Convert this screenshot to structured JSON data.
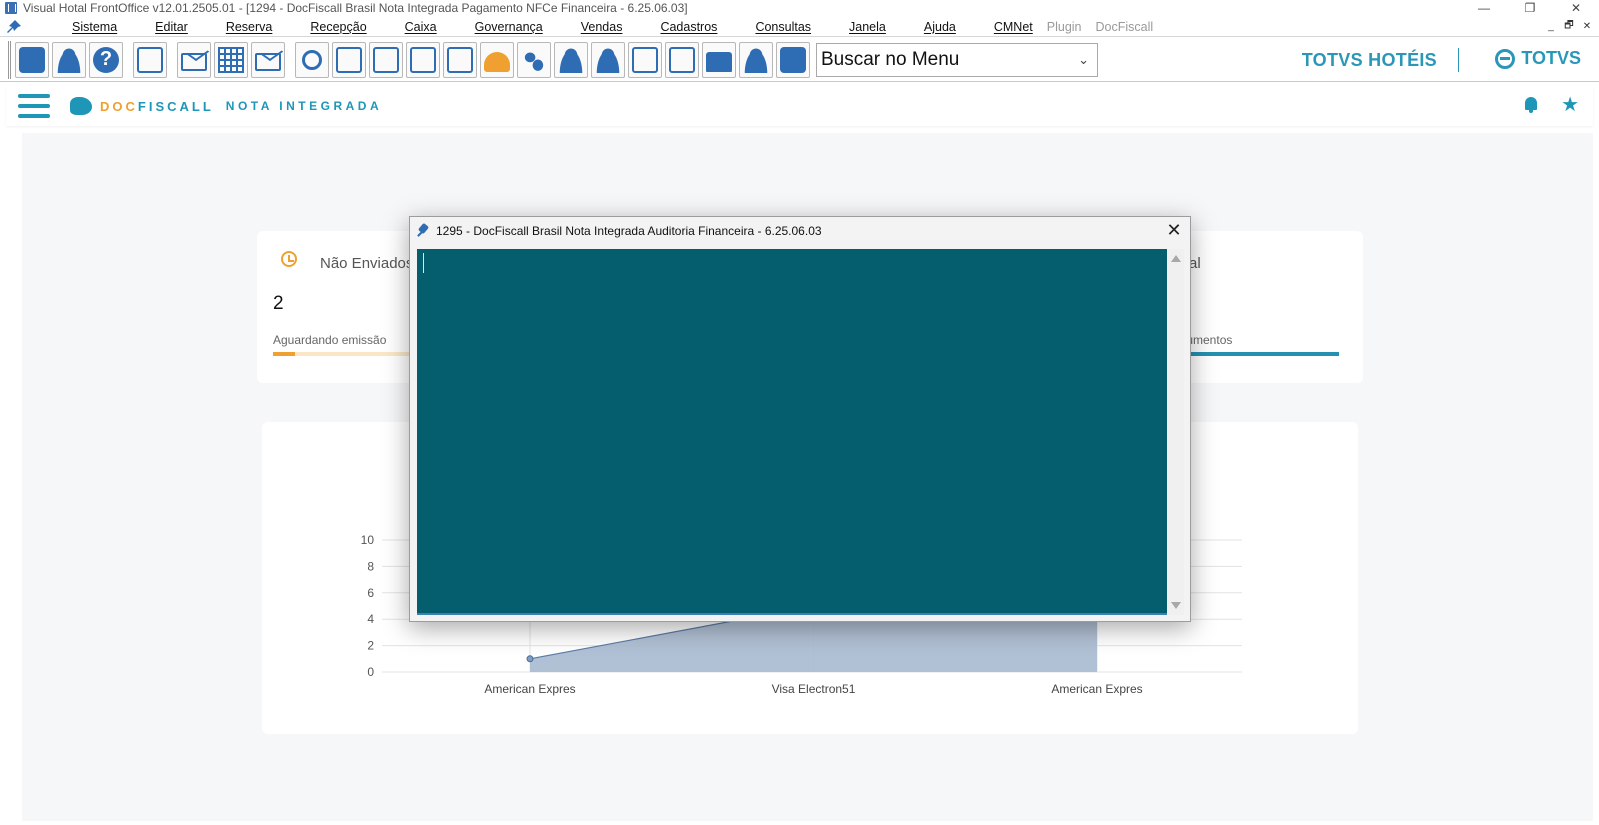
{
  "window": {
    "title": "Visual Hotal FrontOffice v12.01.2505.01 - [1294 - DocFiscall Brasil Nota Integrada Pagamento NFCe Financeira - 6.25.06.03]",
    "controls": {
      "minimize": "—",
      "maximize": "❐",
      "close": "✕"
    }
  },
  "menu": {
    "items": [
      "Sistema",
      "Editar",
      "Reserva",
      "Recepção",
      "Caixa",
      "Governança",
      "Vendas",
      "Cadastros",
      "Consultas",
      "Janela",
      "Ajuda",
      "CMNet",
      "Plugin",
      "DocFiscall"
    ],
    "mdi_controls": {
      "minimize": "_",
      "restore": "🗗",
      "close": "✕"
    }
  },
  "toolbar": {
    "icons": [
      "exit-icon",
      "user-key-icon",
      "help-icon",
      "org-chart-icon",
      "mail-icon",
      "building-edit-icon",
      "mail-send-icon",
      "search-icon",
      "calendar-icon",
      "guest-card-icon",
      "guest-card-2-icon",
      "checklist-icon",
      "bell-service-icon",
      "footsteps-icon",
      "add-user-icon",
      "service-users-icon",
      "cash-report-icon",
      "list-report-icon",
      "cash-register-icon",
      "maid-icon",
      "address-book-icon"
    ],
    "search_menu": "Buscar no Menu"
  },
  "brands": {
    "hoteis": "TOTVS HOTÉIS",
    "totvs": "TOTVS"
  },
  "app_header": {
    "brand_doc": "DOC",
    "brand_fiscall": "FISCALL",
    "brand_nota": "NOTA INTEGRADA"
  },
  "summary": {
    "nao_enviados_label": "Não Enviados",
    "nao_enviados_count": "2",
    "aguardando_label": "Aguardando emissão",
    "aguardando_progress": 0.15,
    "total_label": "Total",
    "documentos_label": "Documentos",
    "accent_orange": "#f0a030",
    "accent_teal": "#2590b0"
  },
  "chart_data": {
    "type": "area",
    "categories": [
      "American Expres",
      "Visa Electron51",
      "American Expres"
    ],
    "values": [
      1,
      5,
      5
    ],
    "yticks": [
      0,
      2,
      4,
      6,
      8,
      10
    ],
    "ylim": [
      0,
      10
    ],
    "title": "",
    "xlabel": "",
    "ylabel": "",
    "grid": true
  },
  "modal": {
    "title": "1295 - DocFiscall Brasil Nota Integrada Auditoria Financeira - 6.25.06.03",
    "close": "✕",
    "content_color": "#055e6e"
  }
}
